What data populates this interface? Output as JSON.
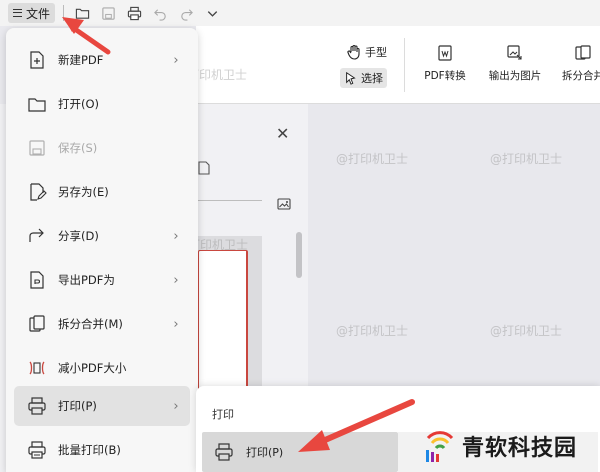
{
  "toolbar": {
    "file_label": "文件",
    "icons": [
      "open-folder-icon",
      "save-icon",
      "print-icon",
      "undo-icon",
      "redo-icon",
      "chevron-down-icon"
    ]
  },
  "ribbon": {
    "hand_label": "手型",
    "select_label": "选择",
    "tools": [
      {
        "label": "PDF转换",
        "icon": "pdf-convert-icon"
      },
      {
        "label": "输出为图片",
        "icon": "export-image-icon"
      },
      {
        "label": "拆分合并",
        "icon": "split-merge-icon"
      }
    ]
  },
  "menu": {
    "items": [
      {
        "label": "新建PDF",
        "icon": "new-pdf-icon",
        "submenu": true,
        "disabled": false
      },
      {
        "label": "打开(O)",
        "icon": "open-icon",
        "submenu": false,
        "disabled": false
      },
      {
        "label": "保存(S)",
        "icon": "save-icon",
        "submenu": false,
        "disabled": true
      },
      {
        "label": "另存为(E)",
        "icon": "save-as-icon",
        "submenu": false,
        "disabled": false
      },
      {
        "label": "分享(D)",
        "icon": "share-icon",
        "submenu": true,
        "disabled": false
      },
      {
        "label": "导出PDF为",
        "icon": "export-pdf-icon",
        "submenu": true,
        "disabled": false
      },
      {
        "label": "拆分合并(M)",
        "icon": "split-merge-icon",
        "submenu": true,
        "disabled": false
      },
      {
        "label": "减小PDF大小",
        "icon": "compress-icon",
        "submenu": false,
        "disabled": false
      },
      {
        "label": "打印(P)",
        "icon": "print-icon",
        "submenu": true,
        "disabled": false,
        "active": true
      },
      {
        "label": "批量打印(B)",
        "icon": "batch-print-icon",
        "submenu": false,
        "disabled": false
      }
    ]
  },
  "submenu": {
    "heading": "打印",
    "item_label": "打印(P)"
  },
  "brand": {
    "name": "青软科技园"
  },
  "watermark": "@打印机卫士",
  "colors": {
    "arrow": "#e8473f",
    "thumb_border": "#c9473f",
    "brand_logo": "#e53935"
  }
}
